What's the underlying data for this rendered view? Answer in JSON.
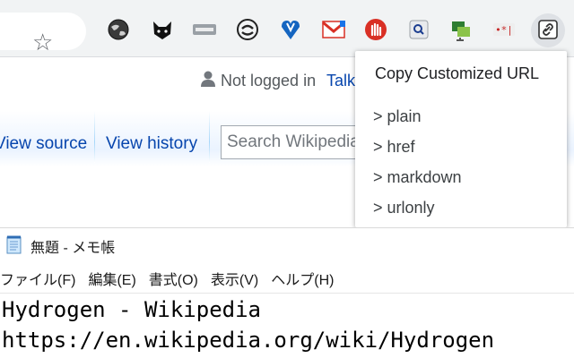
{
  "browser": {
    "bookmark_icon": "star-outline-icon",
    "extensions": [
      "globe-icon",
      "cat-face-icon",
      "privacy-badge-icon",
      "circle-arrows-icon",
      "blue-heart-icon",
      "gmail-icon",
      "red-hand-icon",
      "magnifier-box-icon",
      "green-monitor-icon",
      "dot-star-icon",
      "link-icon"
    ]
  },
  "wiki": {
    "user_status": "Not logged in",
    "talk_link": "Talk",
    "tab_view_source": "View source",
    "tab_view_history": "View history",
    "search_placeholder": "Search Wikipedia"
  },
  "popup": {
    "title": "Copy Customized URL",
    "items": [
      "> plain",
      "> href",
      "> markdown",
      "> urlonly"
    ]
  },
  "notepad": {
    "window_title": "無題 - メモ帳",
    "menu": [
      "ファイル(F)",
      "編集(E)",
      "書式(O)",
      "表示(V)",
      "ヘルプ(H)"
    ],
    "lines": [
      "Hydrogen - Wikipedia",
      "https://en.wikipedia.org/wiki/Hydrogen"
    ]
  },
  "colors": {
    "link": "#0645ad",
    "toolbar_bg": "#f1f3f4",
    "popup_bg": "#ffffff"
  }
}
